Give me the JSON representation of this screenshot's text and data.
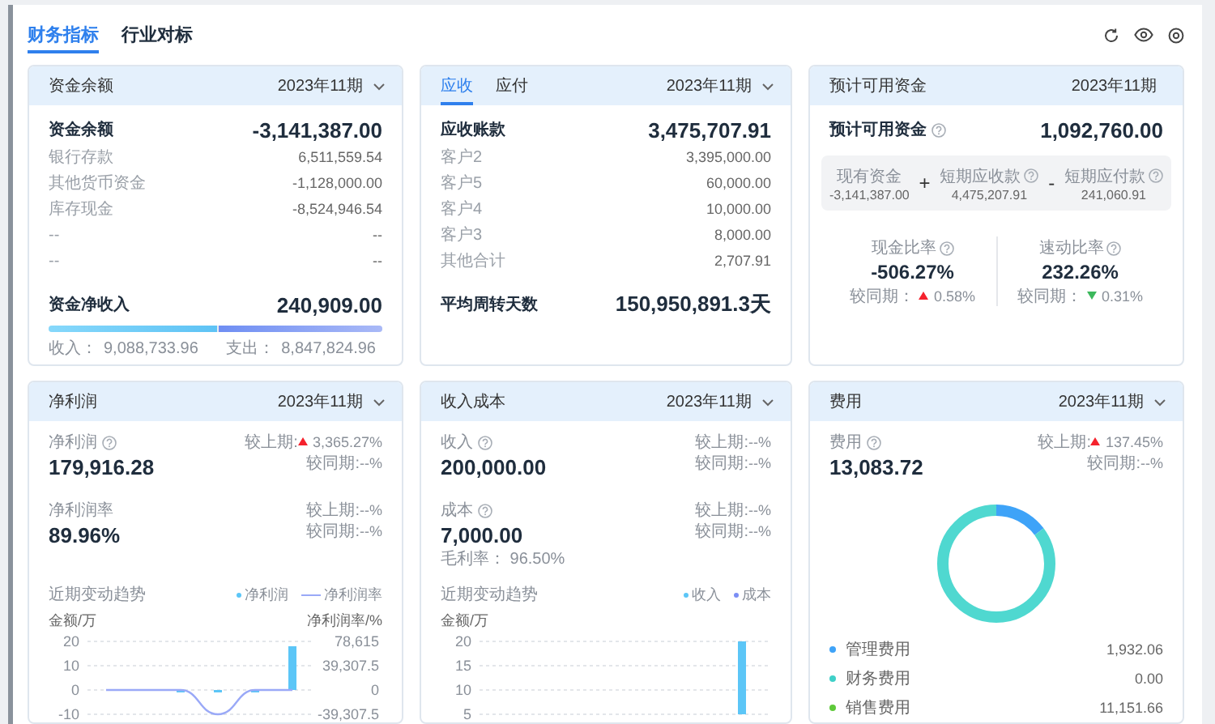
{
  "tabs": [
    {
      "label": "财务指标",
      "selected": true
    },
    {
      "label": "行业对标",
      "selected": false
    }
  ],
  "cards": [
    {
      "kind": "balance",
      "title": "资金余额",
      "period": "2023年11期",
      "dropdown": true,
      "main": {
        "label": "资金余额",
        "value": "-3,141,387.00"
      },
      "rows": [
        {
          "label": "银行存款",
          "value": "6,511,559.54"
        },
        {
          "label": "其他货币资金",
          "value": "-1,128,000.00"
        },
        {
          "label": "库存现金",
          "value": "-8,524,946.54"
        },
        {
          "label": "--",
          "value": "--"
        },
        {
          "label": "--",
          "value": "--"
        }
      ],
      "footer": {
        "label": "资金净收入",
        "value": "240,909.00"
      },
      "flow": {
        "level": 0.507,
        "income_label": "收入：",
        "income": "9,088,733.96",
        "expense_label": "支出：",
        "expense": "8,847,824.96"
      }
    },
    {
      "kind": "receivable",
      "tabs": [
        {
          "label": "应收",
          "selected": true
        },
        {
          "label": "应付",
          "selected": false
        }
      ],
      "period": "2023年11期",
      "dropdown": true,
      "main": {
        "label": "应收账款",
        "value": "3,475,707.91"
      },
      "rows": [
        {
          "label": "客户2",
          "value": "3,395,000.00"
        },
        {
          "label": "客户5",
          "value": "60,000.00"
        },
        {
          "label": "客户4",
          "value": "10,000.00"
        },
        {
          "label": "客户3",
          "value": "8,000.00"
        },
        {
          "label": "其他合计",
          "value": "2,707.91"
        }
      ],
      "footer": {
        "label": "平均周转天数",
        "value": "150,950,891.3天"
      }
    },
    {
      "kind": "available",
      "title": "预计可用资金",
      "period": "2023年11期",
      "dropdown": false,
      "main": {
        "label": "预计可用资金",
        "value": "1,092,760.00"
      },
      "terms": [
        {
          "label": "现有资金",
          "value": "-3,141,387.00",
          "help": false
        },
        {
          "operator": "+",
          "label": "短期应收款",
          "value": "4,475,207.91",
          "help": true
        },
        {
          "operator": "-",
          "label": "短期应付款",
          "value": "241,060.91",
          "help": true
        }
      ],
      "ratios": [
        {
          "label": "现金比率",
          "value": "-506.27%",
          "compare_label": "较同期：",
          "up": true,
          "change": "0.58%"
        },
        {
          "label": "速动比率",
          "value": "232.26%",
          "compare_label": "较同期：",
          "up": false,
          "change": "0.31%"
        }
      ]
    },
    {
      "kind": "profit",
      "title": "净利润",
      "period": "2023年11期",
      "dropdown": true,
      "metrics": [
        {
          "label": "净利润",
          "help": true,
          "value": "179,916.28",
          "compares": [
            {
              "label": "较上期:",
              "up": true,
              "change": "3,365.27%"
            },
            {
              "label": "较同期:",
              "change": "--%"
            }
          ]
        },
        {
          "label": "净利润率",
          "help": false,
          "value": "89.96%",
          "compares": [
            {
              "label": "较上期:",
              "change": "--%"
            },
            {
              "label": "较同期:",
              "change": "--%"
            }
          ]
        }
      ],
      "trend": {
        "title": "近期变动趋势",
        "left_unit": "金额/万",
        "right_unit": "净利润率/%",
        "chart_data": {
          "type": "bar",
          "ylim": [
            -10,
            20
          ],
          "yticks": [
            -10,
            0,
            10,
            20
          ],
          "y2lim": [
            -39307.5,
            78615
          ],
          "y2ticks": [
            {
              "value": -39307.5,
              "label": "-39,307.5"
            },
            {
              "value": 0,
              "label": "0"
            },
            {
              "value": 39307.5,
              "label": "39,307.5"
            },
            {
              "value": 78615,
              "label": "78,615"
            }
          ],
          "series": [
            {
              "name": "净利润",
              "color": "#5cc6f7",
              "values": [
                0,
                0,
                -0.4,
                -0.4,
                -0.4,
                18
              ]
            },
            {
              "name": "净利润率",
              "color": "#9aa9f7",
              "type": "line",
              "axis": "y2",
              "values": [
                0,
                0,
                0,
                -39307.5,
                0,
                0
              ]
            }
          ]
        }
      }
    },
    {
      "kind": "income",
      "title": "收入成本",
      "period": "2023年11期",
      "dropdown": true,
      "metrics": [
        {
          "label": "收入",
          "help": true,
          "value": "200,000.00",
          "compares": [
            {
              "label": "较上期:",
              "change": "--%"
            },
            {
              "label": "较同期:",
              "change": "--%"
            }
          ]
        },
        {
          "label": "成本",
          "help": true,
          "value": "7,000.00",
          "note": "毛利率： 96.50%",
          "compares": [
            {
              "label": "较上期:",
              "change": "--%"
            },
            {
              "label": "较同期:",
              "change": "--%"
            }
          ]
        }
      ],
      "trend": {
        "title": "近期变动趋势",
        "left_unit": "金额/万",
        "chart_data": {
          "type": "bar",
          "ylim": [
            5,
            20
          ],
          "yticks": [
            5,
            10,
            15,
            20
          ],
          "series": [
            {
              "name": "收入",
              "color": "#5cc6f7",
              "values": [
                null,
                null,
                null,
                null,
                null,
                20
              ]
            },
            {
              "name": "成本",
              "color": "#7b8ef5",
              "values": [
                null,
                null,
                null,
                null,
                null,
                null
              ]
            }
          ]
        }
      }
    },
    {
      "kind": "expense",
      "title": "费用",
      "period": "2023年11期",
      "dropdown": true,
      "metrics": [
        {
          "label": "费用",
          "help": true,
          "value": "13,083.72",
          "compares": [
            {
              "label": "较上期:",
              "up": true,
              "change": "137.45%"
            },
            {
              "label": "较同期:",
              "change": "--%"
            }
          ]
        }
      ],
      "chart_data": {
        "type": "donut",
        "categories": [
          "管理费用",
          "财务费用",
          "销售费用"
        ],
        "values": [
          14.77,
          0,
          85.23
        ],
        "colors": [
          "#3ea3f8",
          "#3fd0c8",
          "#4fd8d0"
        ]
      },
      "legend": [
        {
          "value": "1,932.06",
          "color": "#3ea3f8"
        },
        {
          "value": "0.00",
          "color": "#3fd0c8"
        },
        {
          "value": "11,151.66",
          "color": "#5ec93a"
        }
      ]
    }
  ]
}
